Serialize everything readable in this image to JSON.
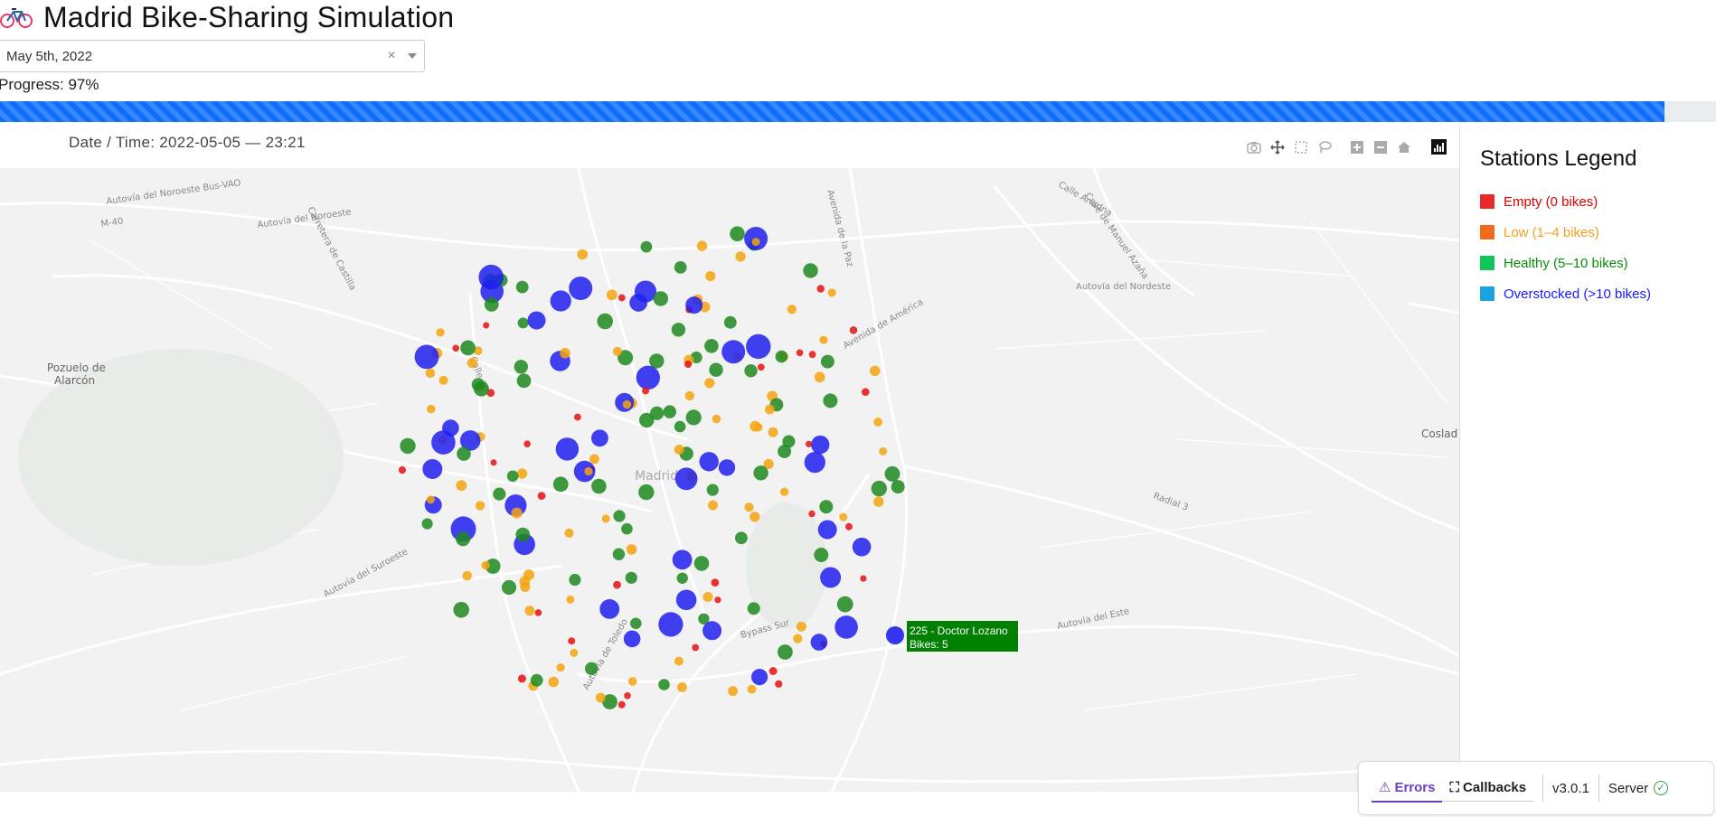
{
  "app": {
    "title": "Madrid Bike-Sharing Simulation",
    "icon": "bicycle-icon"
  },
  "date_picker": {
    "value": "May 5th, 2022",
    "clear_symbol": "×"
  },
  "progress": {
    "label": "Progress: 97%",
    "value": 97,
    "color": "#0d6efd"
  },
  "graph": {
    "title": "Date / Time: 2022-05-05 — 23:21",
    "modebar_icons": [
      "camera-icon",
      "pan-icon",
      "box-select-icon",
      "lasso-icon",
      "zoom-in-icon",
      "zoom-out-icon",
      "reset-home-icon",
      "plotly-logo-icon"
    ]
  },
  "map": {
    "labels": [
      "Autovía del Noroeste Bus-VAO",
      "Autovía del Noroeste",
      "Carretera de Castilla",
      "Calle 30",
      "M-40",
      "Pozuelo de",
      "Alarcón",
      "Avenida de la Paz",
      "Calle Ariadna",
      "Calle de Manuel Azaña",
      "Autovía del Nordeste",
      "Avenida de América",
      "Coslad",
      "Madrid",
      "Radial 3",
      "Autovía del Suroeste",
      "Autovía de Toledo",
      "Bypass Sur",
      "Autovía del Este"
    ],
    "tooltip": {
      "line1": "225 - Doctor Lozano",
      "line2": "Bikes: 5",
      "color": "#008000"
    }
  },
  "legend": {
    "title": "Stations Legend",
    "items": [
      {
        "label": "Empty (0 bikes)",
        "color": "#e8282b",
        "text_color": "#e00000"
      },
      {
        "label": "Low (1–4 bikes)",
        "color": "#f26b1d",
        "text_color": "#f0a020"
      },
      {
        "label": "Healthy (5–10 bikes)",
        "color": "#12c45b",
        "text_color": "#0a8a0a"
      },
      {
        "label": "Overstocked (>10 bikes)",
        "color": "#1aa3e0",
        "text_color": "#1a1aff"
      }
    ]
  },
  "devtools": {
    "errors_label": "Errors",
    "callbacks_label": "Callbacks",
    "version": "v3.0.1",
    "server_label": "Server"
  }
}
